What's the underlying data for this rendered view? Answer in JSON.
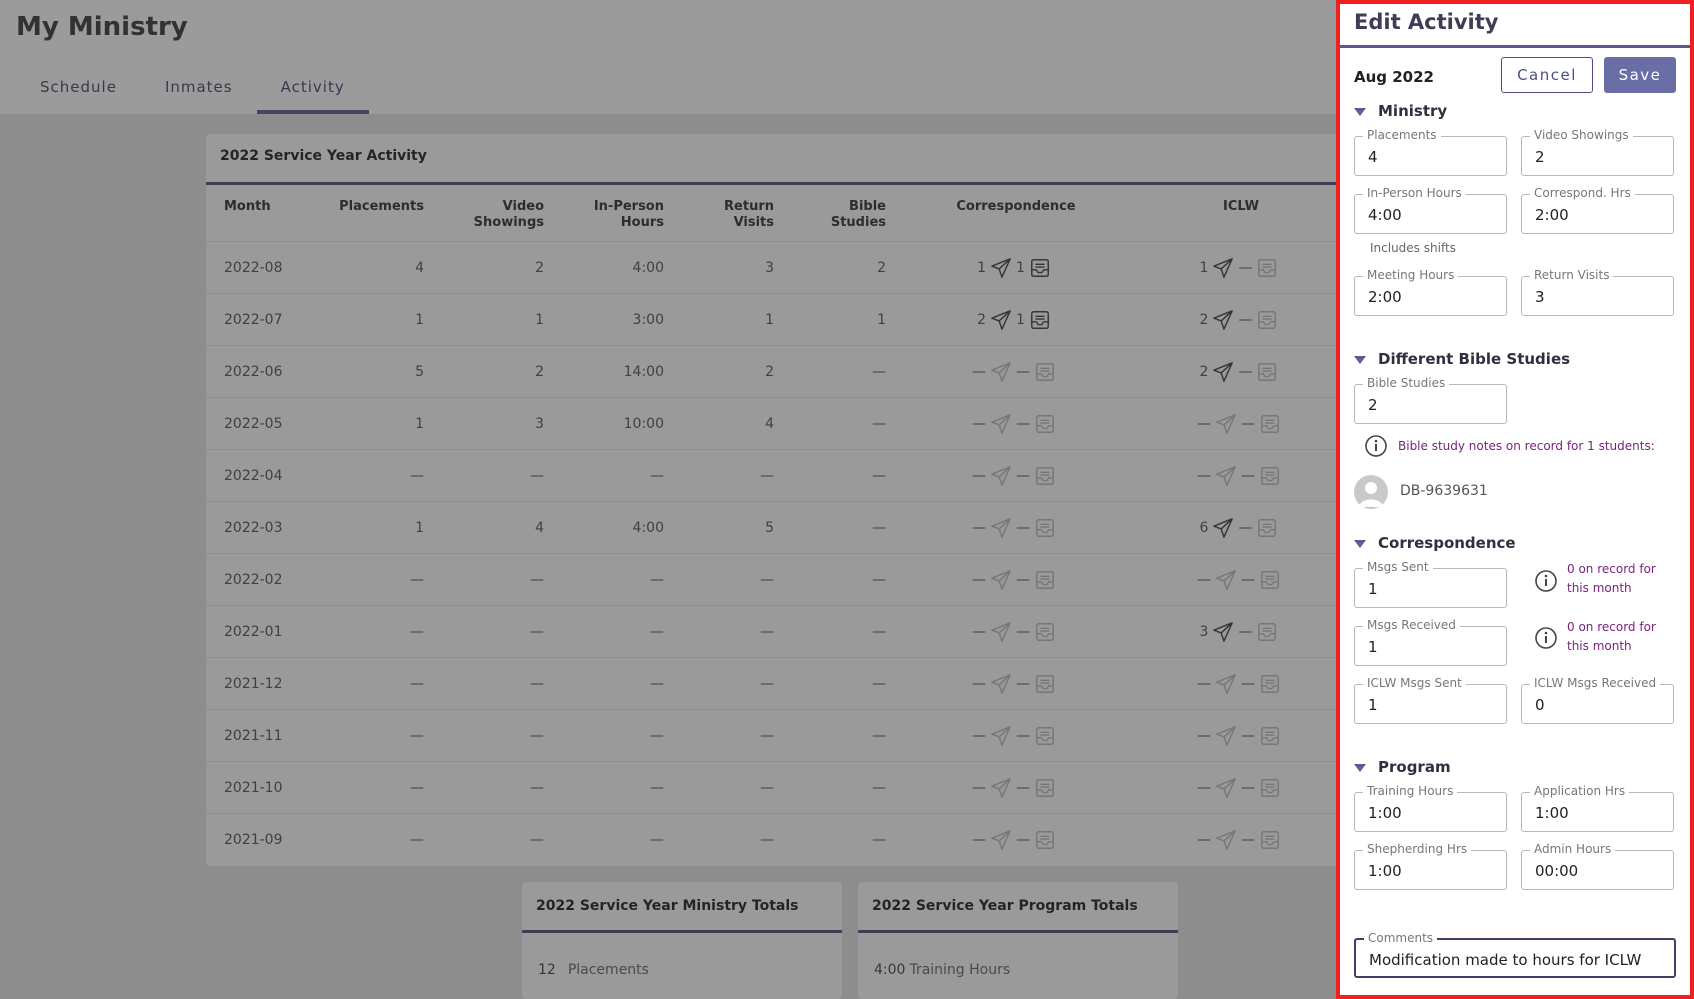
{
  "app": {
    "title": "My Ministry",
    "tabs": [
      "Schedule",
      "Inmates",
      "Activity"
    ],
    "active_tab": "Activity"
  },
  "activity_card": {
    "title": "2022 Service Year Activity",
    "columns": {
      "month": "Month",
      "placements": "Placements",
      "video": "Video Showings",
      "inperson": "In-Person Hours",
      "return_visits": "Return Visits",
      "bible_studies": "Bible Studies",
      "correspondence": "Correspondence",
      "iclw": "ICLW"
    },
    "rows": [
      {
        "month": "2022-08",
        "placements": "4",
        "video": "2",
        "inperson": "4:00",
        "rv": "3",
        "bs": "2",
        "corr_sent": "1",
        "corr_recv": "1",
        "iclw_sent": "1",
        "iclw_recv": "—"
      },
      {
        "month": "2022-07",
        "placements": "1",
        "video": "1",
        "inperson": "3:00",
        "rv": "1",
        "bs": "1",
        "corr_sent": "2",
        "corr_recv": "1",
        "iclw_sent": "2",
        "iclw_recv": "—"
      },
      {
        "month": "2022-06",
        "placements": "5",
        "video": "2",
        "inperson": "14:00",
        "rv": "2",
        "bs": "—",
        "corr_sent": "—",
        "corr_recv": "—",
        "iclw_sent": "2",
        "iclw_recv": "—"
      },
      {
        "month": "2022-05",
        "placements": "1",
        "video": "3",
        "inperson": "10:00",
        "rv": "4",
        "bs": "—",
        "corr_sent": "—",
        "corr_recv": "—",
        "iclw_sent": "—",
        "iclw_recv": "—"
      },
      {
        "month": "2022-04",
        "placements": "—",
        "video": "—",
        "inperson": "—",
        "rv": "—",
        "bs": "—",
        "corr_sent": "—",
        "corr_recv": "—",
        "iclw_sent": "—",
        "iclw_recv": "—"
      },
      {
        "month": "2022-03",
        "placements": "1",
        "video": "4",
        "inperson": "4:00",
        "rv": "5",
        "bs": "—",
        "corr_sent": "—",
        "corr_recv": "—",
        "iclw_sent": "6",
        "iclw_recv": "—"
      },
      {
        "month": "2022-02",
        "placements": "—",
        "video": "—",
        "inperson": "—",
        "rv": "—",
        "bs": "—",
        "corr_sent": "—",
        "corr_recv": "—",
        "iclw_sent": "—",
        "iclw_recv": "—"
      },
      {
        "month": "2022-01",
        "placements": "—",
        "video": "—",
        "inperson": "—",
        "rv": "—",
        "bs": "—",
        "corr_sent": "—",
        "corr_recv": "—",
        "iclw_sent": "3",
        "iclw_recv": "—"
      },
      {
        "month": "2021-12",
        "placements": "—",
        "video": "—",
        "inperson": "—",
        "rv": "—",
        "bs": "—",
        "corr_sent": "—",
        "corr_recv": "—",
        "iclw_sent": "—",
        "iclw_recv": "—"
      },
      {
        "month": "2021-11",
        "placements": "—",
        "video": "—",
        "inperson": "—",
        "rv": "—",
        "bs": "—",
        "corr_sent": "—",
        "corr_recv": "—",
        "iclw_sent": "—",
        "iclw_recv": "—"
      },
      {
        "month": "2021-10",
        "placements": "—",
        "video": "—",
        "inperson": "—",
        "rv": "—",
        "bs": "—",
        "corr_sent": "—",
        "corr_recv": "—",
        "iclw_sent": "—",
        "iclw_recv": "—"
      },
      {
        "month": "2021-09",
        "placements": "—",
        "video": "—",
        "inperson": "—",
        "rv": "—",
        "bs": "—",
        "corr_sent": "—",
        "corr_recv": "—",
        "iclw_sent": "—",
        "iclw_recv": "—"
      }
    ]
  },
  "ministry_totals": {
    "title": "2022 Service Year Ministry Totals",
    "value": "12",
    "label": "Placements"
  },
  "program_totals": {
    "title": "2022 Service Year Program Totals",
    "value": "4:00",
    "label": "Training Hours"
  },
  "panel": {
    "title": "Edit Activity",
    "period": "Aug 2022",
    "cancel_label": "Cancel",
    "save_label": "Save",
    "ministry": {
      "heading": "Ministry",
      "placements": {
        "label": "Placements",
        "value": "4"
      },
      "video": {
        "label": "Video Showings",
        "value": "2"
      },
      "inperson": {
        "label": "In-Person Hours",
        "value": "4:00"
      },
      "correspond": {
        "label": "Correspond. Hrs",
        "value": "2:00"
      },
      "includes_shifts": "Includes shifts",
      "meeting": {
        "label": "Meeting Hours",
        "value": "2:00"
      },
      "return_visits": {
        "label": "Return Visits",
        "value": "3"
      }
    },
    "bible": {
      "heading": "Different Bible Studies",
      "studies": {
        "label": "Bible Studies",
        "value": "2"
      },
      "note": "Bible study notes on record for 1 students:",
      "student_id": "DB-9639631"
    },
    "correspondence": {
      "heading": "Correspondence",
      "sent": {
        "label": "Msgs Sent",
        "value": "1"
      },
      "sent_note_1": "0 on record for",
      "sent_note_2": "this month",
      "received": {
        "label": "Msgs Received",
        "value": "1"
      },
      "recv_note_1": "0 on record for",
      "recv_note_2": "this month",
      "iclw_sent": {
        "label": "ICLW Msgs Sent",
        "value": "1"
      },
      "iclw_received": {
        "label": "ICLW Msgs Received",
        "value": "0"
      }
    },
    "program": {
      "heading": "Program",
      "training": {
        "label": "Training Hours",
        "value": "1:00"
      },
      "application": {
        "label": "Application Hrs",
        "value": "1:00"
      },
      "shepherding": {
        "label": "Shepherding Hrs",
        "value": "1:00"
      },
      "admin": {
        "label": "Admin Hours",
        "value": "00:00"
      }
    },
    "comments": {
      "label": "Comments",
      "value": "Modification made to hours for ICLW"
    }
  }
}
